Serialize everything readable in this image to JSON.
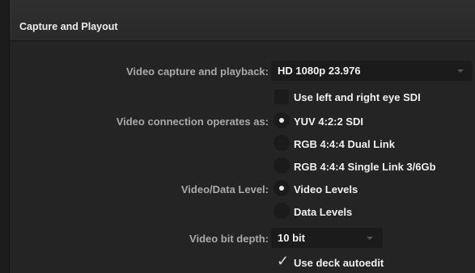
{
  "panel": {
    "title": "Capture and Playout"
  },
  "video_capture": {
    "label": "Video capture and playback:",
    "value": "HD 1080p 23.976"
  },
  "left_right_eye": {
    "label": "Use left and right eye SDI",
    "checked": false
  },
  "connection": {
    "label": "Video connection operates as:",
    "options": [
      {
        "label": "YUV 4:2:2 SDI",
        "selected": true
      },
      {
        "label": "RGB 4:4:4 Dual Link",
        "selected": false
      },
      {
        "label": "RGB 4:4:4 Single Link 3/6Gb",
        "selected": false
      }
    ]
  },
  "data_level": {
    "label": "Video/Data Level:",
    "options": [
      {
        "label": "Video Levels",
        "selected": true
      },
      {
        "label": "Data Levels",
        "selected": false
      }
    ]
  },
  "bit_depth": {
    "label": "Video bit depth:",
    "value": "10 bit"
  },
  "deck_autoedit": {
    "label": "Use deck autoedit",
    "checked": true
  },
  "icons": {
    "dropdown": "chevron-down-icon",
    "checkmark": "checkmark-icon"
  }
}
